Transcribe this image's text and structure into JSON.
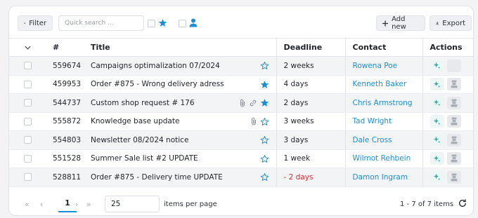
{
  "toolbar": {
    "filter_label": "Filter",
    "search_placeholder": "Quick search ...",
    "add_label": "Add new",
    "export_label": "Export"
  },
  "columns": [
    "#",
    "Title",
    "Deadline",
    "Contact",
    "Actions"
  ],
  "rows": [
    {
      "id": "559674",
      "title": "Campaigns optimalization 07/2024",
      "starred": false,
      "attach": false,
      "link": false,
      "deadline": "2 weeks",
      "overdue": false,
      "contact": "Rowena Poe"
    },
    {
      "id": "459953",
      "title": "Order #875 - Wrong delivery adress",
      "starred": true,
      "attach": false,
      "link": false,
      "deadline": "4 days",
      "overdue": false,
      "contact": "Kenneth Baker"
    },
    {
      "id": "544737",
      "title": "Custom shop request # 176",
      "starred": true,
      "attach": true,
      "link": true,
      "deadline": "2 days",
      "overdue": false,
      "contact": "Chris Armstrong"
    },
    {
      "id": "555872",
      "title": "Knowledge base update",
      "starred": false,
      "attach": true,
      "link": false,
      "deadline": "3 weeks",
      "overdue": false,
      "contact": "Tad Wright"
    },
    {
      "id": "554803",
      "title": "Newsletter 08/2024 notice",
      "starred": false,
      "attach": false,
      "link": false,
      "deadline": "3 days",
      "overdue": false,
      "contact": "Dale Cross"
    },
    {
      "id": "551528",
      "title": "Summer Sale list #2 UPDATE",
      "starred": false,
      "attach": false,
      "link": false,
      "deadline": "1 week",
      "overdue": false,
      "contact": "Wilmot Rehbein"
    },
    {
      "id": "528811",
      "title": "Order #875 - Delivery time UPDATE",
      "starred": false,
      "attach": false,
      "link": false,
      "deadline": "- 2 days",
      "overdue": true,
      "contact": "Damon Ingram"
    }
  ],
  "pagination": {
    "current_page": "1",
    "per_page": "25",
    "per_page_label": "items per page",
    "range": "1 - 7 of 7 items"
  },
  "colors": {
    "accent": "#1a8fd6",
    "overdue": "#e0282e",
    "row_alt": "#f3f4f6",
    "ai_icon": "#2aa79b"
  }
}
